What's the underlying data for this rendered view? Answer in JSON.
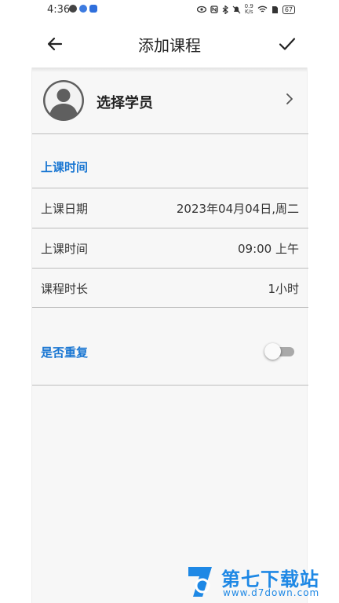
{
  "status_bar": {
    "time": "4:36",
    "speed_value": "0.9",
    "speed_unit": "K/s",
    "battery": "67"
  },
  "app_bar": {
    "title": "添加课程",
    "back_icon": "arrow-left-icon",
    "confirm_icon": "check-icon"
  },
  "student": {
    "label": "选择学员",
    "avatar_icon": "user-avatar-icon",
    "chevron_icon": "chevron-right-icon"
  },
  "schedule_section": {
    "title": "上课时间",
    "rows": [
      {
        "label": "上课日期",
        "value": "2023年04月04日,周二"
      },
      {
        "label": "上课时间",
        "value": "09:00 上午"
      },
      {
        "label": "课程时长",
        "value": "1小时"
      }
    ]
  },
  "repeat": {
    "label": "是否重复",
    "enabled": false
  },
  "watermark": {
    "name": "第七下载站",
    "url": "www.d7down.com"
  },
  "colors": {
    "accent": "#1976d2",
    "panel_background": "#f7f7f7",
    "divider": "#bdbdbd",
    "watermark": "#1e88e5"
  }
}
